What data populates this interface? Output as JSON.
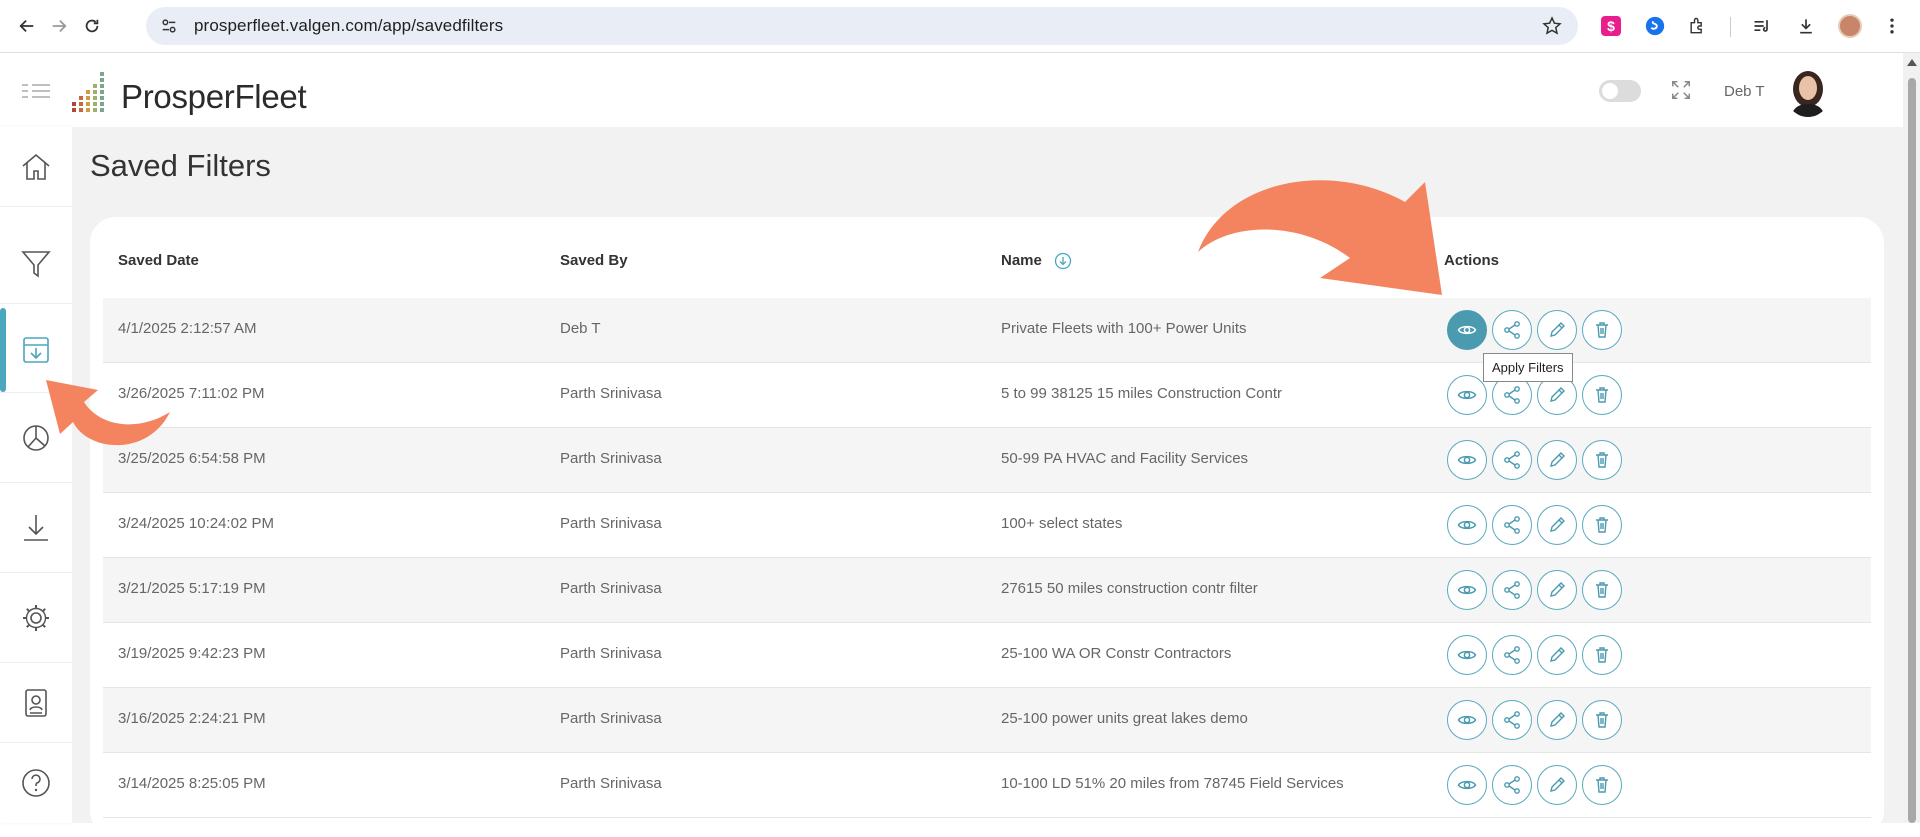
{
  "browser": {
    "url": "prosperfleet.valgen.com/app/savedfilters",
    "icons": [
      "back-icon",
      "forward-icon",
      "reload-icon",
      "site-settings-icon",
      "bookmark-star-icon",
      "extension-icon",
      "puzzle-icon",
      "media-icon",
      "download-icon",
      "profile-icon",
      "menu-icon"
    ]
  },
  "app": {
    "logo_text": "ProsperFleet",
    "user_name": "Deb T",
    "accent_color": "#4a9ab0",
    "arrow_color": "#f4845f"
  },
  "sidebar": {
    "items": [
      {
        "icon": "home-icon"
      },
      {
        "icon": "filter-icon"
      },
      {
        "icon": "saved-filters-icon",
        "active": true
      },
      {
        "icon": "chart-pie-icon"
      },
      {
        "icon": "download-icon"
      },
      {
        "icon": "settings-icon"
      },
      {
        "icon": "contact-card-icon"
      },
      {
        "icon": "help-icon"
      }
    ]
  },
  "page": {
    "title": "Saved Filters",
    "columns": {
      "saved_date": "Saved Date",
      "saved_by": "Saved By",
      "name": "Name",
      "actions": "Actions"
    },
    "rows": [
      {
        "date": "4/1/2025 2:12:57 AM",
        "by": "Deb T",
        "name": "Private Fleets with 100+ Power Units"
      },
      {
        "date": "3/26/2025 7:11:02 PM",
        "by": "Parth Srinivasa",
        "name": "5 to 99 38125 15 miles Construction Contr"
      },
      {
        "date": "3/25/2025 6:54:58 PM",
        "by": "Parth Srinivasa",
        "name": "50-99 PA HVAC and Facility Services"
      },
      {
        "date": "3/24/2025 10:24:02 PM",
        "by": "Parth Srinivasa",
        "name": "100+ select states"
      },
      {
        "date": "3/21/2025 5:17:19 PM",
        "by": "Parth Srinivasa",
        "name": "27615 50 miles construction contr filter"
      },
      {
        "date": "3/19/2025 9:42:23 PM",
        "by": "Parth Srinivasa",
        "name": "25-100 WA OR Constr Contractors"
      },
      {
        "date": "3/16/2025 2:24:21 PM",
        "by": "Parth Srinivasa",
        "name": "25-100 power units great lakes demo"
      },
      {
        "date": "3/14/2025 8:25:05 PM",
        "by": "Parth Srinivasa",
        "name": "10-100 LD 51% 20 miles from 78745 Field Services"
      }
    ],
    "tooltip": "Apply Filters"
  }
}
